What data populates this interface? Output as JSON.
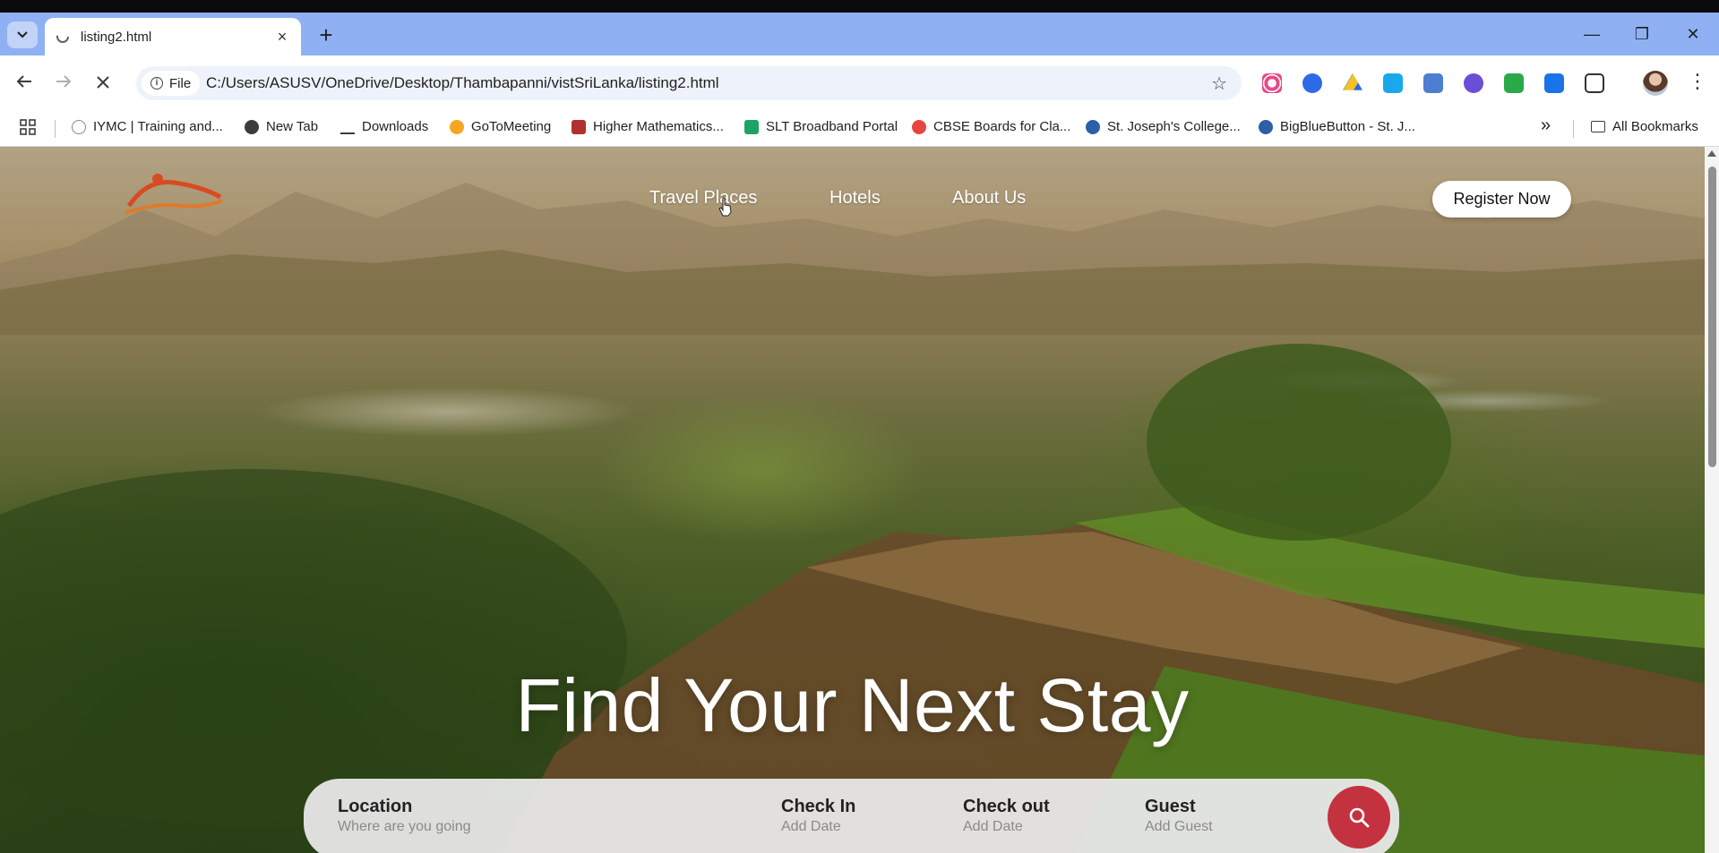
{
  "browser": {
    "tab_title": "listing2.html",
    "new_tab_symbol": "+",
    "close_tab_symbol": "×",
    "window_controls": {
      "minimize": "—",
      "restore": "❐",
      "close": "✕"
    },
    "chip_label": "File",
    "address": "C:/Users/ASUSV/OneDrive/Desktop/Thambapanni/vistSriLanka/listing2.html",
    "loading": true,
    "bookmarks": [
      {
        "label": "IYMC | Training and...",
        "icon": "iymc-icon"
      },
      {
        "label": "New Tab",
        "icon": "globe-icon"
      },
      {
        "label": "Downloads",
        "icon": "download-icon"
      },
      {
        "label": "GoToMeeting",
        "icon": "gotomeeting-icon"
      },
      {
        "label": "Higher Mathematics...",
        "icon": "pdf-icon"
      },
      {
        "label": "SLT Broadband Portal",
        "icon": "slt-icon"
      },
      {
        "label": "CBSE Boards for Cla...",
        "icon": "tiktok-icon"
      },
      {
        "label": "St. Joseph's College...",
        "icon": "bigbluebutton-icon"
      },
      {
        "label": "BigBlueButton - St. J...",
        "icon": "bigbluebutton-icon"
      }
    ],
    "more_bookmarks_symbol": "»",
    "all_bookmarks_label": "All Bookmarks",
    "extension_colors": [
      "#e64a8a",
      "#2d6ae8",
      "#1ea362",
      "#1aa7ec",
      "#4e7ecf",
      "#6b4ed8",
      "#2aa84a",
      "#1a73e8",
      "#333333"
    ]
  },
  "site": {
    "nav": {
      "links": [
        "Travel Places",
        "Hotels",
        "About Us"
      ],
      "register_label": "Register Now"
    },
    "hero_title": "Find Your Next Stay",
    "search": {
      "location_label": "Location",
      "location_placeholder": "Where are you going",
      "checkin_label": "Check In",
      "checkin_placeholder": "Add Date",
      "checkout_label": "Check out",
      "checkout_placeholder": "Add Date",
      "guest_label": "Guest",
      "guest_placeholder": "Add Guest"
    },
    "accent_color": "#c4323f"
  }
}
